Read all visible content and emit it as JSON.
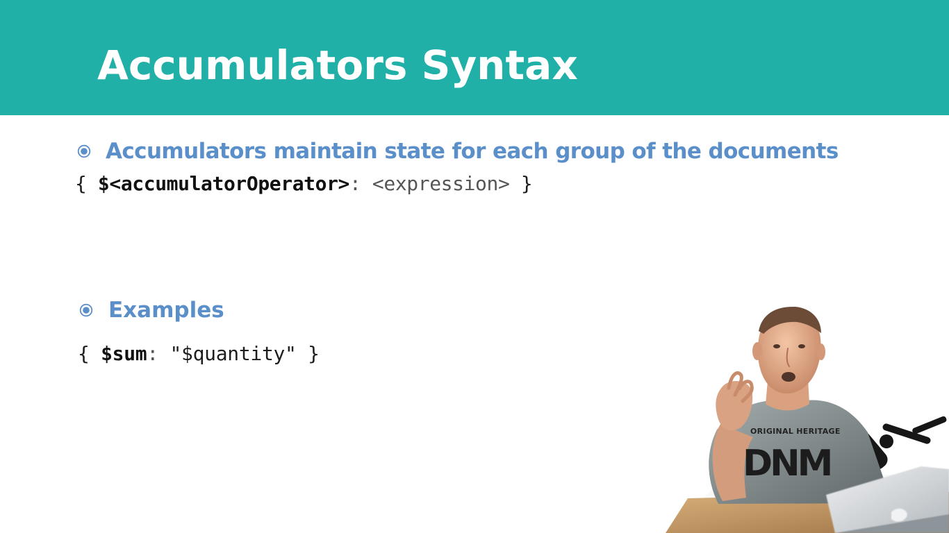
{
  "slide": {
    "title": "Accumulators Syntax"
  },
  "bullets": [
    {
      "icon": "radio-bullet-icon",
      "text": "Accumulators maintain state for each group of the documents"
    },
    {
      "icon": "radio-bullet-icon",
      "text": "Examples"
    }
  ],
  "code": {
    "syntax": {
      "open": "{ ",
      "operator": "$<accumulatorOperator>",
      "colon": ":",
      "expression": " <expression> ",
      "close": "}"
    },
    "example": {
      "open": "{ ",
      "operator": "$sum",
      "colon": ":",
      "value": " \"$quantity\" ",
      "close": "}"
    }
  },
  "webcam": {
    "shirt_text": "ORIGINAL HERITAGE",
    "shirt_graphic": "DNM"
  },
  "colors": {
    "title_bar": "#20b0a8",
    "title_text": "#ffffff",
    "bullet_text": "#5a8fc9",
    "code_text": "#1d1d1d"
  }
}
